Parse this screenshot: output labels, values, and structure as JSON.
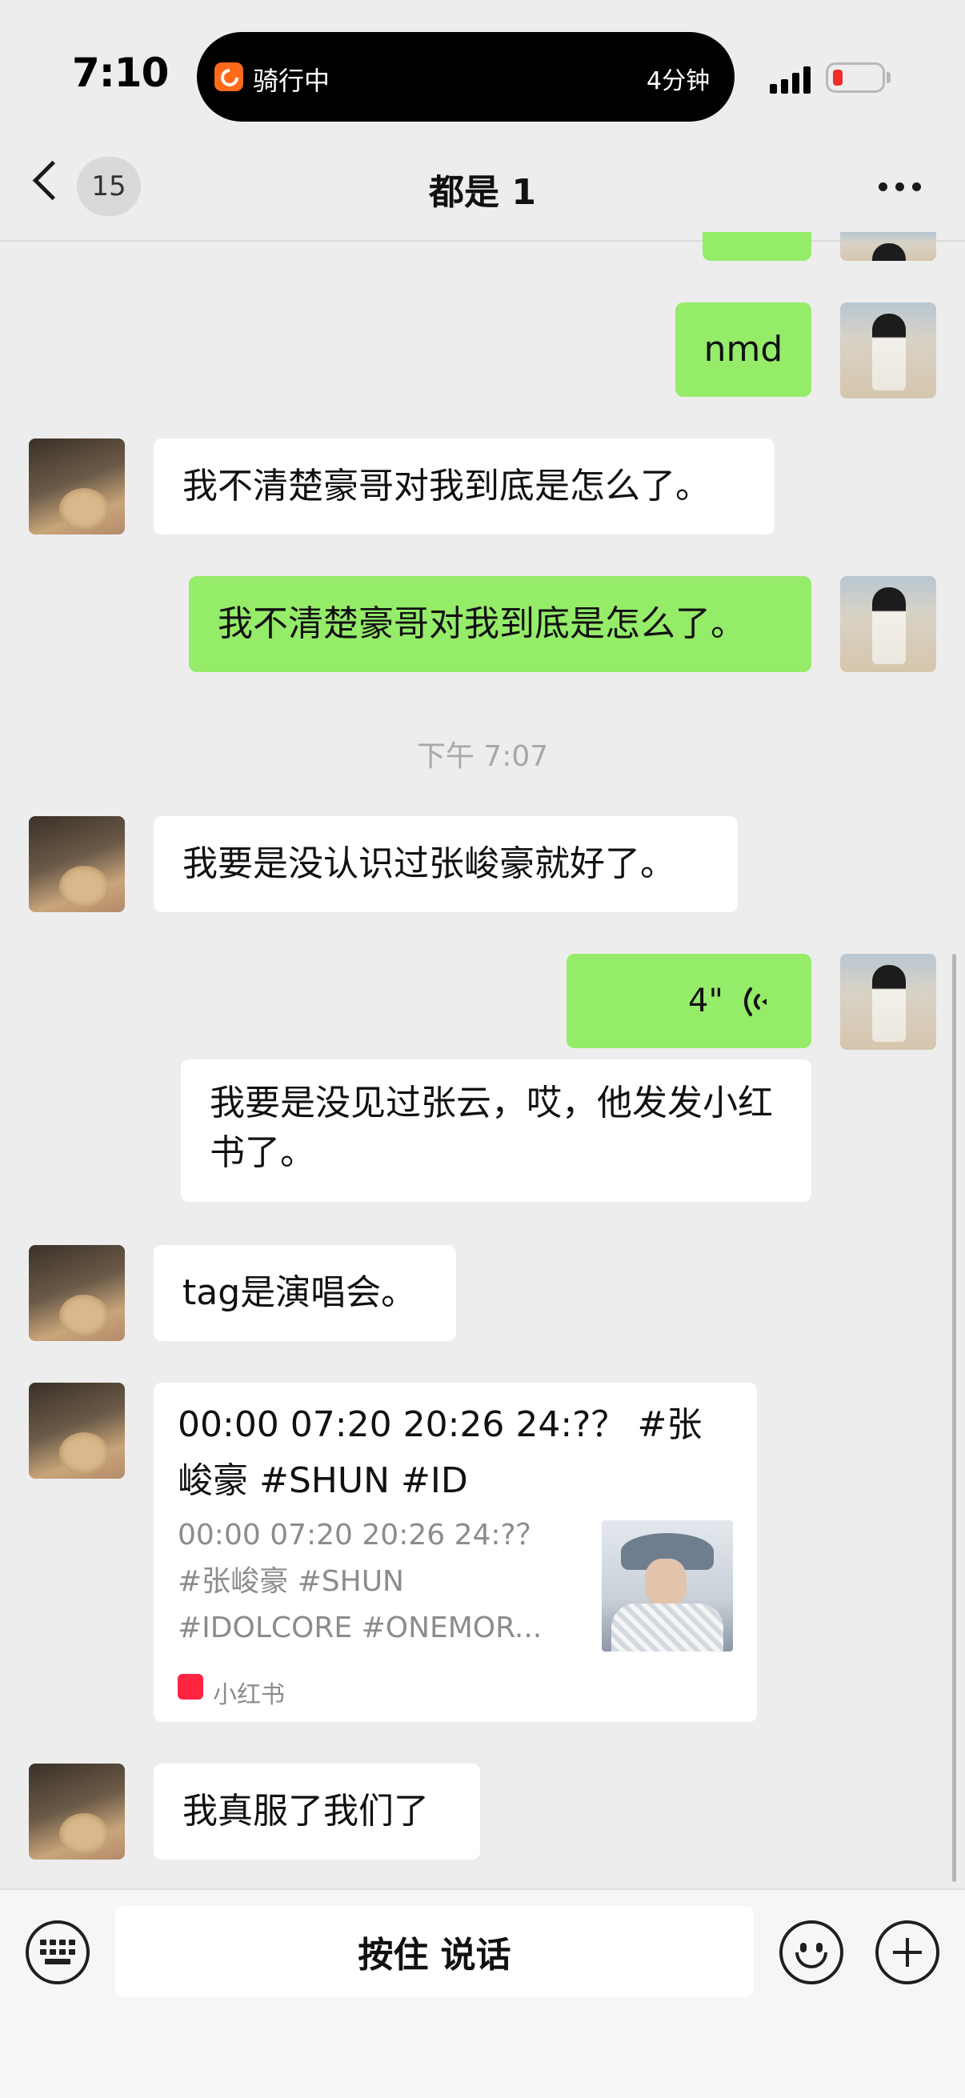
{
  "status_bar": {
    "time": "7:10",
    "live_activity": {
      "title": "骑行中",
      "duration": "4分钟"
    },
    "battery_level": 0.12
  },
  "nav": {
    "back_badge": "15",
    "title": "都是 1"
  },
  "messages": [
    {
      "side": "right",
      "type": "text",
      "text": "nmd"
    },
    {
      "side": "left",
      "type": "text",
      "text": "我不清楚豪哥对我到底是怎么了。"
    },
    {
      "side": "right",
      "type": "text",
      "text": "我不清楚豪哥对我到底是怎么了。"
    },
    {
      "type": "timestamp",
      "text": "下午 7:07"
    },
    {
      "side": "left",
      "type": "text",
      "text": "我要是没认识过张峻豪就好了。"
    },
    {
      "side": "right",
      "type": "voice",
      "duration": "4\"",
      "transcript": "我要是没见过张云，哎，他发发小红书了。"
    },
    {
      "side": "left",
      "type": "text",
      "text": "tag是演唱会。"
    },
    {
      "side": "left",
      "type": "card",
      "title": "00:00 07:20 20:26 24:?？ #张峻豪 #SHUN #ID",
      "description": "00:00 07:20 20:26 24:?？#张峻豪 #SHUN #IDOLCORE #ONEMOR...",
      "source": "小红书",
      "source_logo_text": "小红书"
    },
    {
      "side": "left",
      "type": "text",
      "text": "我真服了我们了"
    }
  ],
  "input_bar": {
    "talk_label": "按住 说话",
    "icons": [
      "keyboard-icon",
      "emoji-icon",
      "plus-icon"
    ]
  },
  "colors": {
    "background": "#ededed",
    "sent_bubble": "#95ec69",
    "received_bubble": "#ffffff",
    "battery_low": "#f02d2d",
    "app_accent": "#ff6a1a"
  }
}
